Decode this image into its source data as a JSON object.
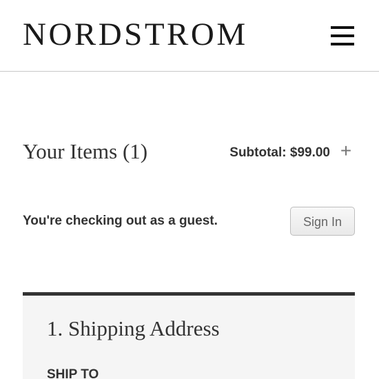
{
  "header": {
    "logo": "NORDSTROM",
    "menu_icon": "hamburger-menu-icon"
  },
  "cart": {
    "title": "Your Items (1)",
    "subtotal": "Subtotal: $99.00",
    "expand_symbol": "+"
  },
  "guest": {
    "message": "You're checking out as a guest.",
    "sign_in_label": "Sign In"
  },
  "shipping": {
    "title": "1. Shipping Address",
    "ship_to_label": "SHIP TO"
  }
}
